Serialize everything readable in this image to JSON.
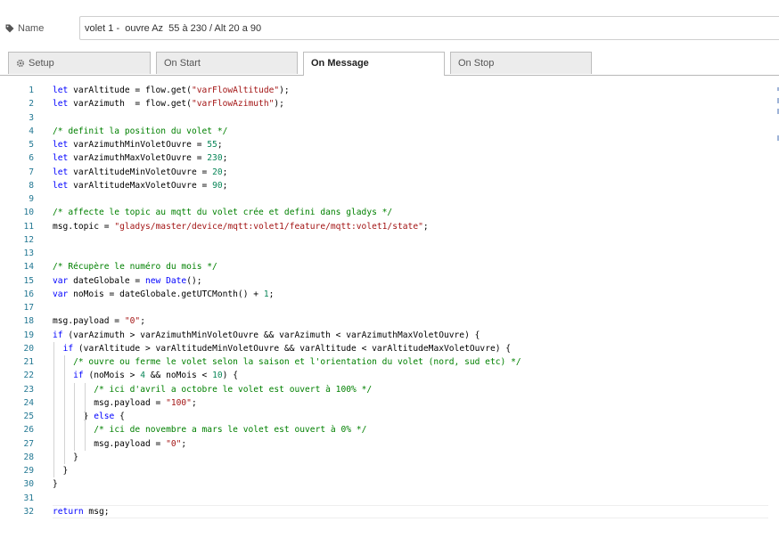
{
  "name_field": {
    "label": "Name",
    "value": "volet 1 -  ouvre Az  55 à 230 / Alt 20 a 90"
  },
  "tabs": [
    {
      "label": "Setup",
      "icon": "gear-icon",
      "active": false
    },
    {
      "label": "On Start",
      "active": false
    },
    {
      "label": "On Message",
      "active": true
    },
    {
      "label": "On Stop",
      "active": false
    }
  ],
  "editor": {
    "lines": [
      {
        "n": "1",
        "text": "let varAltitude = flow.get(\"varFlowAltitude\");"
      },
      {
        "n": "2",
        "text": "let varAzimuth  = flow.get(\"varFlowAzimuth\");"
      },
      {
        "n": "3",
        "text": ""
      },
      {
        "n": "4",
        "text": "/* definit la position du volet */"
      },
      {
        "n": "5",
        "text": "let varAzimuthMinVoletOuvre = 55;"
      },
      {
        "n": "6",
        "text": "let varAzimuthMaxVoletOuvre = 230;"
      },
      {
        "n": "7",
        "text": "let varAltitudeMinVoletOuvre = 20;"
      },
      {
        "n": "8",
        "text": "let varAltitudeMaxVoletOuvre = 90;"
      },
      {
        "n": "9",
        "text": ""
      },
      {
        "n": "10",
        "text": "/* affecte le topic au mqtt du volet crée et defini dans gladys */"
      },
      {
        "n": "11",
        "text": "msg.topic = \"gladys/master/device/mqtt:volet1/feature/mqtt:volet1/state\";"
      },
      {
        "n": "12",
        "text": ""
      },
      {
        "n": "13",
        "text": ""
      },
      {
        "n": "14",
        "text": "/* Récupère le numéro du mois */"
      },
      {
        "n": "15",
        "text": "var dateGlobale = new Date();"
      },
      {
        "n": "16",
        "text": "var noMois = dateGlobale.getUTCMonth() + 1;"
      },
      {
        "n": "17",
        "text": ""
      },
      {
        "n": "18",
        "text": "msg.payload = \"0\";"
      },
      {
        "n": "19",
        "text": "if (varAzimuth > varAzimuthMinVoletOuvre && varAzimuth < varAzimuthMaxVoletOuvre) {"
      },
      {
        "n": "20",
        "text": "  if (varAltitude > varAltitudeMinVoletOuvre && varAltitude < varAltitudeMaxVoletOuvre) {"
      },
      {
        "n": "21",
        "text": "    /* ouvre ou ferme le volet selon la saison et l'orientation du volet (nord, sud etc) */"
      },
      {
        "n": "22",
        "text": "    if (noMois > 4 && noMois < 10) {"
      },
      {
        "n": "23",
        "text": "        /* ici d'avril a octobre le volet est ouvert à 100% */"
      },
      {
        "n": "24",
        "text": "        msg.payload = \"100\";"
      },
      {
        "n": "25",
        "text": "      } else {"
      },
      {
        "n": "26",
        "text": "        /* ici de novembre a mars le volet est ouvert à 0% */"
      },
      {
        "n": "27",
        "text": "        msg.payload = \"0\";"
      },
      {
        "n": "28",
        "text": "    }"
      },
      {
        "n": "29",
        "text": "  }"
      },
      {
        "n": "30",
        "text": "}"
      },
      {
        "n": "31",
        "text": ""
      },
      {
        "n": "32",
        "text": "return msg;"
      }
    ]
  },
  "colors": {
    "keyword": "#0000ff",
    "string": "#a31515",
    "number": "#098658",
    "comment": "#008000",
    "line_number": "#237893"
  }
}
